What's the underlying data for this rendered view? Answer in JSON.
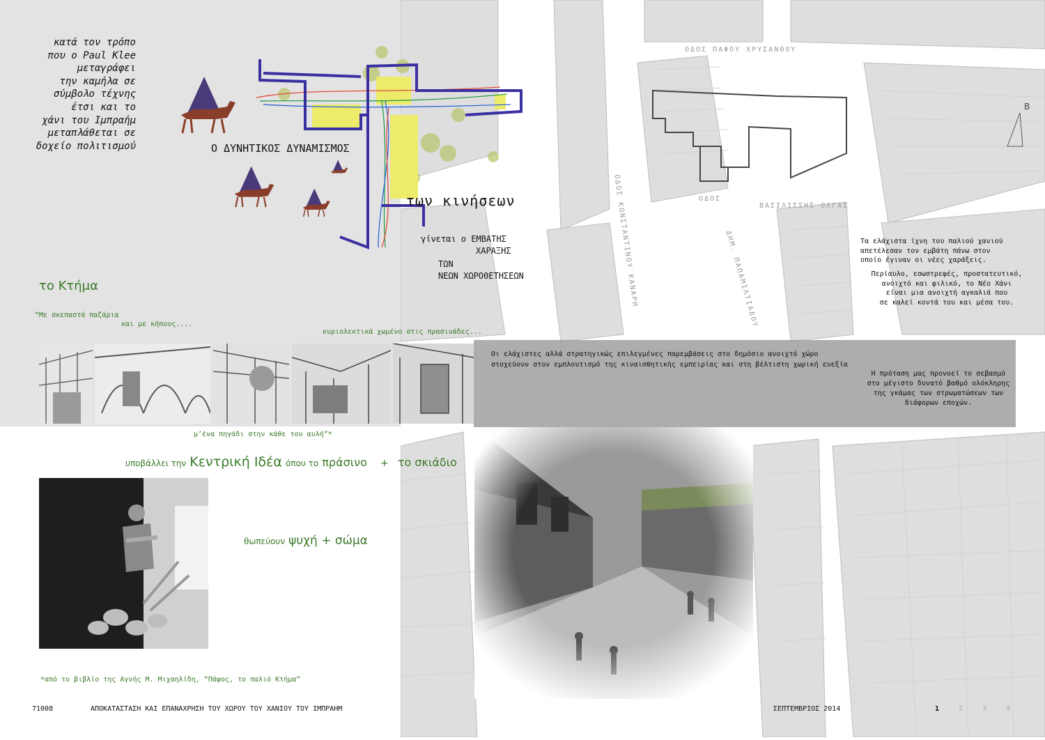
{
  "poem": "κατά τον τρόπο\nπου ο Paul Klee\nμεταγράφει\nτην καμήλα σε\nσύμβολο τέχνης\nέτσι και το\nχάνι του Ιμπραήμ\nμεταπλάθεται σε\nδοχείο πολιτισμού",
  "diagram": {
    "title_line1": "Ο ΔΥΝΗΤΙΚΟΣ ΔΥΝΑΜΙΣΜΟΣ",
    "title_line2": "των κινήσεων",
    "sub1": "γίνεται ο ΕΜΒΑΤΗΣ",
    "sub2": "ΧΑΡΑΞΗΣ",
    "sub3": "ΤΩΝ",
    "sub4": "ΝΕΩΝ ΧΩΡΟΘΕΤΗΣΕΩΝ"
  },
  "ktima": {
    "heading": "το Κτήμα",
    "quote1": "“Με σκεπαστά παζάρια",
    "quote2": "και με κήπους....",
    "quote3": "κυριολεκτικά χωμένο στις πρασινάδες...",
    "quote4": "μ’ένα πηγάδι στην κάθε του αυλή”*"
  },
  "idea": {
    "p1": "υποβάλλει την",
    "p2": "Κεντρική Ιδέα",
    "p3": "όπου το",
    "p4": "πράσινο",
    "p5": "+",
    "p6": "το σκιάδιο",
    "t1": "θωπεύουν",
    "t2": "ψυχή + σώμα"
  },
  "footnote": "*από το βιβλίο της Αγνής Μ. Μιχαηλίδη, “Πάφος, το παλιό Κτήμα”",
  "right_text": {
    "para1": "Τα ελάχιστα ίχνη του παλιού χανιού\nαπετέλεσαν τον εμβάτη πάνω στον\nοποίο έγιναν οι νέες χαράξεις.",
    "para2": "Περίαυλο, εσωστρεφές, προστατευτικό,\nανοιχτό και φιλικό, το Νέο Χάνι\nείναι μια ανοιχτή αγκαλιά που\nσε καλεί κοντά του και μέσα του.",
    "band1": "Οι ελάχιστες αλλά στρατηγικώς επιλεγμένες παρεμβάσεις στο δημόσιο ανοιχτό χώρο\nστοχεύουν στον εμπλουτισμό της κιναισθητικής εμπειρίας και στη βέλτιστη χωρική ευεξία",
    "band2": "Η πρόταση μας προνοεί το σεβασμό\nστο μέγιστο δυνατό βαθμό ολόκληρης\nτης γκάμας των στρωματώσεων των\nδιάφορων εποχών."
  },
  "map_labels": {
    "street1": "ΟΔΟΣ ΠΑΦΟΥ ΧΡΥΣΑΝΘΟΥ",
    "street2": "ΟΔΟΣ ΚΩΝΣΤΑΝΤΙΝΟΥ ΚΑΝΑΡΗ",
    "street3": "ΟΔΟΣ",
    "street4": "ΒΑΣΙΛΙΣΣΗΣ ΟΛΓΑΣ",
    "street5": "ΔΗΜ. ΠΑΠΑΜΙΛΤΙΑΔΟΥ",
    "north": "Β"
  },
  "footer": {
    "code": "71008",
    "title": "ΑΠΟΚΑΤΑΣΤΑΣΗ ΚΑΙ ΕΠΑΝΑΧΡΗΣΗ ΤΟΥ ΧΩΡΟΥ ΤΟΥ ΧΑΝΙΟΥ ΤΟΥ ΙΜΠΡΑΗΜ",
    "date": "ΣΕΠΤΕΜΒΡΙΟΣ 2014",
    "pages": [
      "1",
      "2",
      "3",
      "4"
    ]
  },
  "colors": {
    "accent_green": "#3b7a2a",
    "diagram_blue": "#3a2fa0",
    "highlight_yellow": "#ecec6a"
  }
}
